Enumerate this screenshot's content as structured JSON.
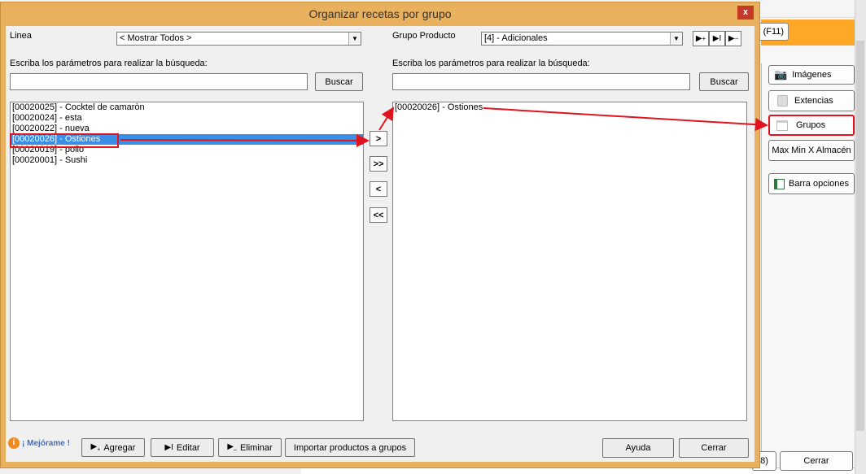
{
  "background": {
    "f11_button": "r (F11)",
    "side_buttons": [
      {
        "label": "Imágenes",
        "icon": "camera-icon"
      },
      {
        "label": "Extencias",
        "icon": "cube-icon"
      },
      {
        "label": "Grupos",
        "icon": "window-icon"
      },
      {
        "label": "Max Min X Almacén",
        "icon": ""
      },
      {
        "label": "Barra opciones",
        "icon": "panel-icon"
      }
    ],
    "bottom_partial": "8)",
    "bottom_close": "Cerrar"
  },
  "window": {
    "title": "Organizar recetas por grupo",
    "close_glyph": "x",
    "left": {
      "line_label": "Linea",
      "line_value": "< Mostrar Todos >",
      "search_label": "Escriba los parámetros para realizar la búsqueda:",
      "search_value": "",
      "search_button": "Buscar",
      "items": [
        "[00020025] - Cocktel de camaròn",
        "[00020024] - esta",
        "[00020022] - nueva",
        "[00020026] - Ostiones",
        "[00020019] - pollo",
        "[00020001] - Sushi"
      ],
      "selected_index": 3
    },
    "move_buttons": [
      ">",
      ">>",
      "<",
      "<<"
    ],
    "right": {
      "group_label": "Grupo Producto",
      "group_value": "[4] - Adicionales",
      "search_label": "Escriba los parámetros para realizar la búsqueda:",
      "search_value": "",
      "search_button": "Buscar",
      "items": [
        "[00020026] - Ostiones"
      ]
    },
    "footer": {
      "mejorame": "¡ Mejórame !",
      "add": "Agregar",
      "edit": "Editar",
      "delete": "Eliminar",
      "import": "Importar productos a grupos",
      "help": "Ayuda",
      "close": "Cerrar"
    }
  },
  "colors": {
    "window_frame": "#e9b15e",
    "selection": "#3a8ee6",
    "annotation": "#e0141e",
    "orange_bar": "#ffa726"
  }
}
